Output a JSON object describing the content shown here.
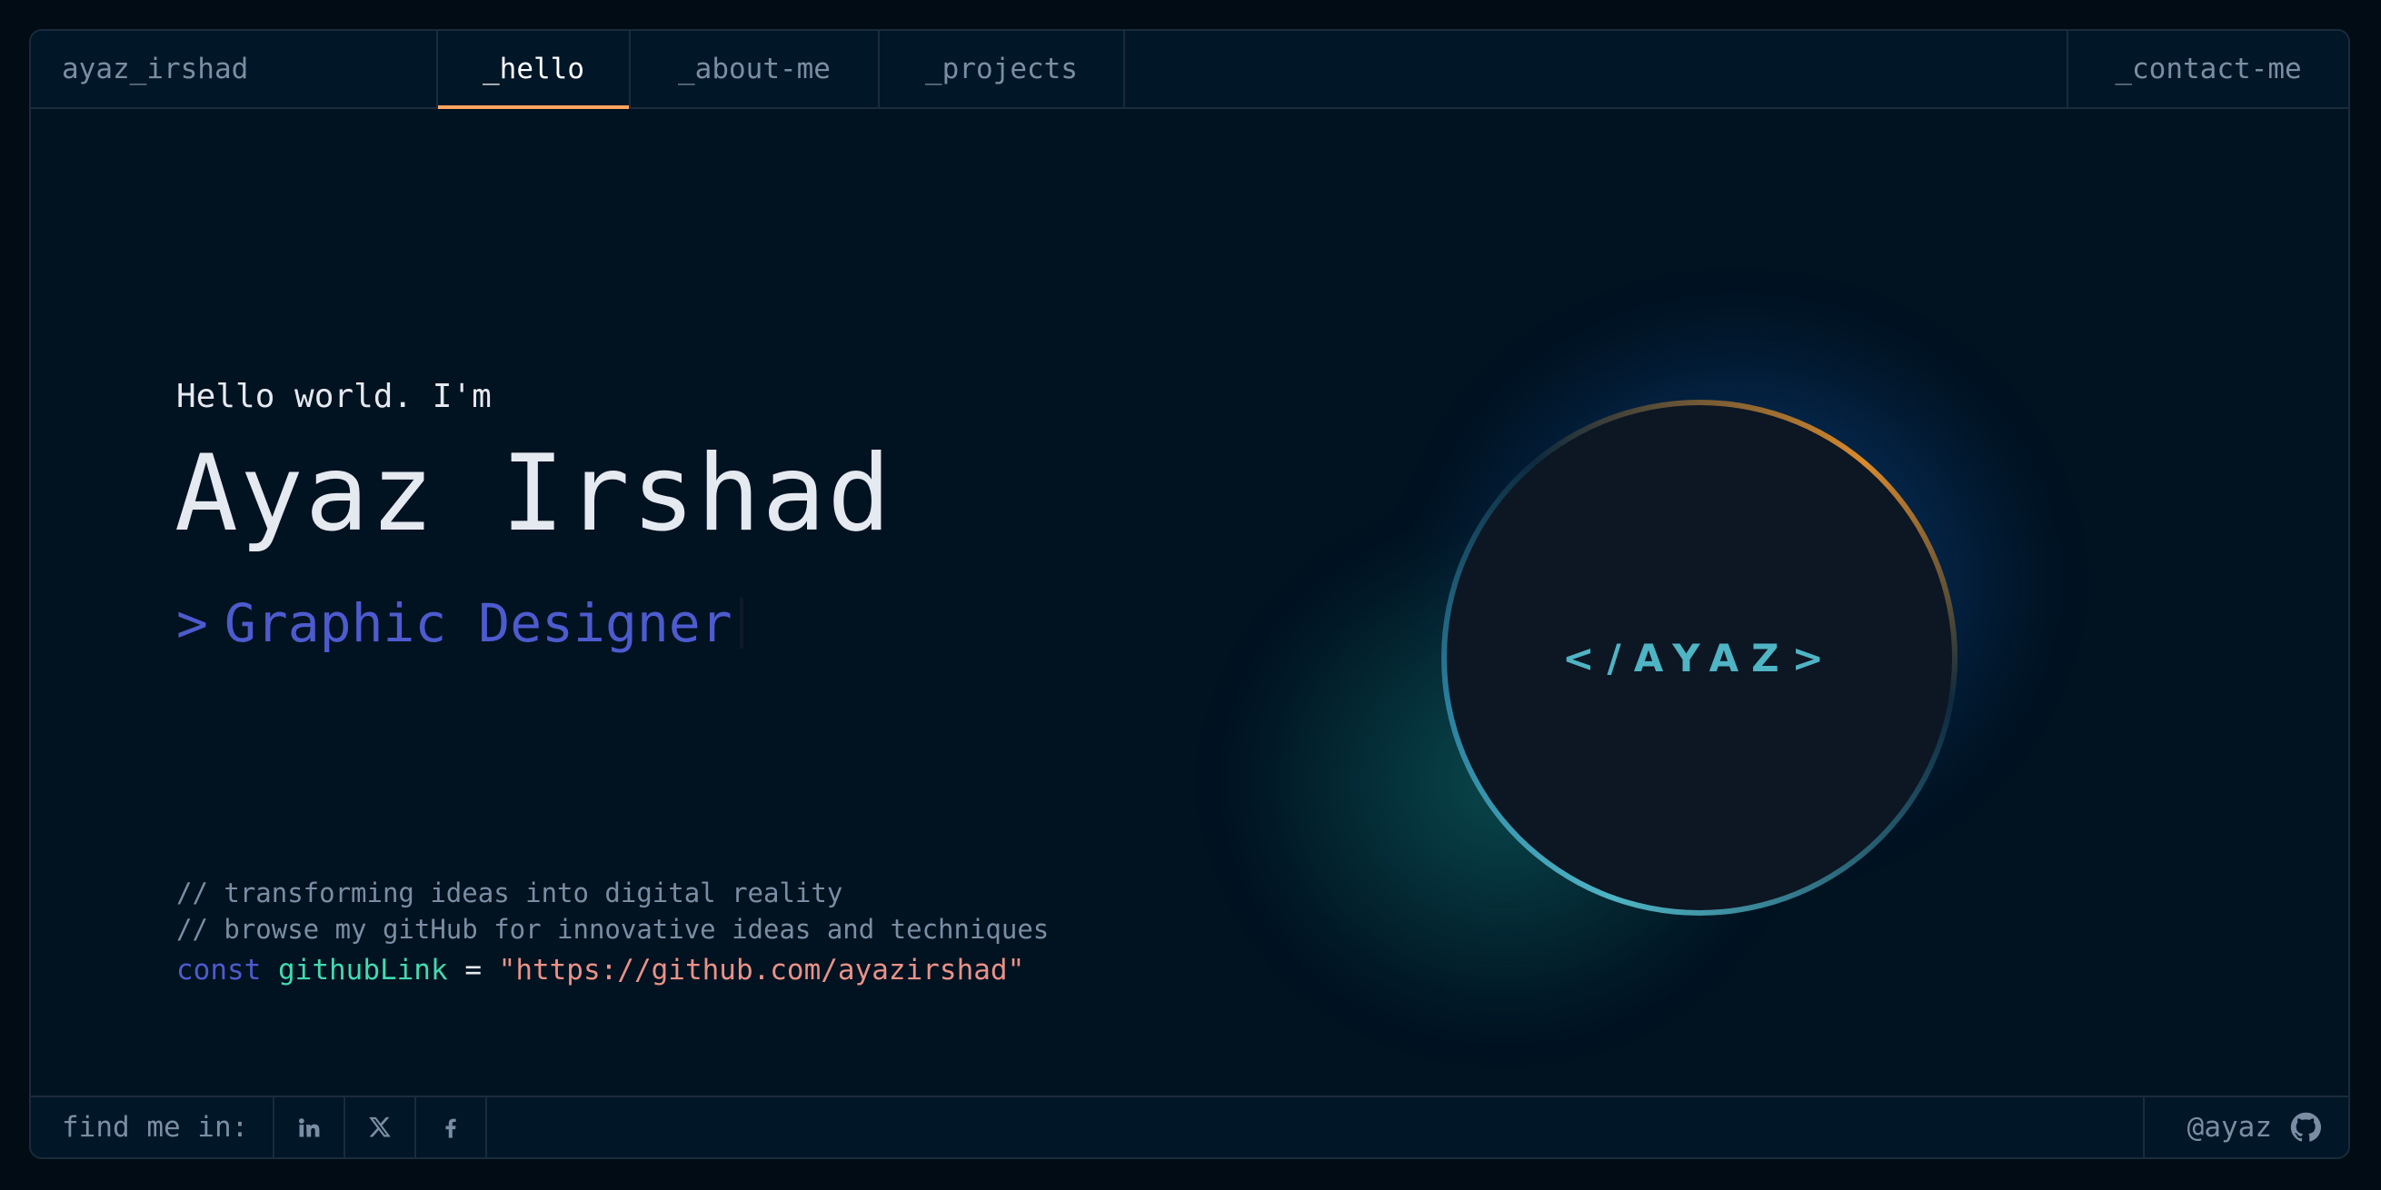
{
  "header": {
    "brand": "ayaz_irshad",
    "tabs": {
      "hello": "_hello",
      "about": "_about-me",
      "projects": "_projects",
      "contact": "_contact-me"
    },
    "active_tab": "hello"
  },
  "hero": {
    "greeting": "Hello world. I'm",
    "name": "Ayaz Irshad",
    "role_prompt": ">",
    "role": "Graphic Designer",
    "comment_1": "// transforming ideas into digital reality",
    "comment_2": "// browse my gitHub for innovative ideas and techniques",
    "code": {
      "keyword": "const",
      "variable": "githubLink",
      "operator": "=",
      "value": "\"https://github.com/ayazirshad\""
    },
    "logo_text": "</AYAZ>"
  },
  "footer": {
    "find_label": "find me in:",
    "socials": [
      "linkedin-icon",
      "x-icon",
      "facebook-icon"
    ],
    "github_handle": "@ayaz",
    "github_icon": "github-icon"
  },
  "colors": {
    "accent_orange": "#fea55f",
    "keyword_blue": "#4d5bce",
    "variable_green": "#43d9ad",
    "string_salmon": "#e99287",
    "logo_teal": "#4fb4c4",
    "background": "#011221"
  }
}
